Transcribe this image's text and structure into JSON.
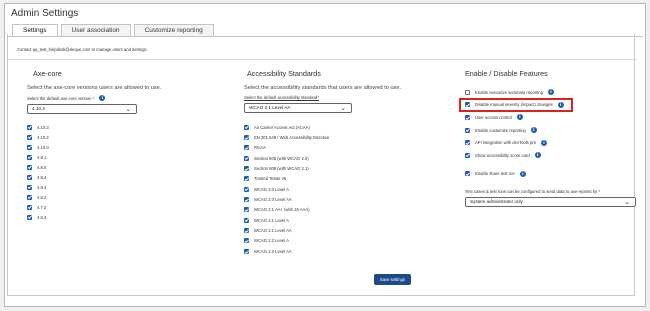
{
  "window": {
    "title": "Admin Settings"
  },
  "tabs": [
    {
      "label": "Settings",
      "active": true
    },
    {
      "label": "User association",
      "active": false
    },
    {
      "label": "Customize reporting",
      "active": false
    }
  ],
  "contact_text": "Contact qa_test_helpdesk@deque.com to manage users and settings.",
  "axe_core": {
    "heading": "Axe-core",
    "description": "Select the axe-core versions users are allowed to use.",
    "default_label": "Select the default axe-core version *",
    "default_value": "4.10.3",
    "versions": [
      {
        "label": "4.10.3",
        "checked": true
      },
      {
        "label": "4.10.2",
        "checked": true
      },
      {
        "label": "4.10.0",
        "checked": true
      },
      {
        "label": "4.9.1",
        "checked": true
      },
      {
        "label": "4.9.0",
        "checked": true
      },
      {
        "label": "4.8.4",
        "checked": true
      },
      {
        "label": "4.8.3",
        "checked": true
      },
      {
        "label": "4.8.2",
        "checked": true
      },
      {
        "label": "4.7.2",
        "checked": true
      },
      {
        "label": "4.6.3",
        "checked": true
      }
    ]
  },
  "standards": {
    "heading": "Accessibility Standards",
    "description": "Select the accessibility standards that users are allowed to use.",
    "default_label": "Select the default accessibility standard*",
    "default_value": "WCAG 2.1 Level AA",
    "items": [
      {
        "label": "Air Carrier Access Act (ACAA)",
        "checked": true
      },
      {
        "label": "EN 301 549 / Web Accessibility Directive",
        "checked": true
      },
      {
        "label": "RGAA",
        "checked": true
      },
      {
        "label": "Section 508 (with WCAG 2.0)",
        "checked": true
      },
      {
        "label": "Section 508 (with WCAG 2.1)",
        "checked": true
      },
      {
        "label": "Trusted Tester v5",
        "checked": true
      },
      {
        "label": "WCAG 2.0 Level A",
        "checked": true
      },
      {
        "label": "WCAG 2.0 Level AA",
        "checked": true
      },
      {
        "label": "WCAG 2.1 AA+ (with 15 AAA)",
        "checked": true
      },
      {
        "label": "WCAG 2.1 Level A",
        "checked": true
      },
      {
        "label": "WCAG 2.1 Level AA",
        "checked": true
      },
      {
        "label": "WCAG 2.2 Level A",
        "checked": true
      },
      {
        "label": "WCAG 2.2 Level AA",
        "checked": true
      }
    ]
  },
  "features": {
    "heading": "Enable / Disable Features",
    "items": [
      {
        "label": "Enable executive summary reporting",
        "checked": false
      },
      {
        "label": "Disable manual severity (impact) changes",
        "checked": true
      },
      {
        "label": "User access control",
        "checked": true
      },
      {
        "label": "Enable customize reporting",
        "checked": true
      },
      {
        "label": "API integration with devTools pro",
        "checked": true
      },
      {
        "label": "Show accessibility score card",
        "checked": true
      },
      {
        "label": "Enable share test run",
        "checked": true
      }
    ],
    "ship_label": "Test cases & test runs can be configured to send data to axe-reports by *",
    "ship_value": "System administrator only"
  },
  "save_button": {
    "label": "Save settings"
  },
  "icons": {
    "info": "info-icon",
    "chevron": "chevron-down-icon"
  },
  "colors": {
    "accent": "#1f5fa8",
    "highlight": "#d9261c",
    "save_button": "#1f4a8a"
  }
}
